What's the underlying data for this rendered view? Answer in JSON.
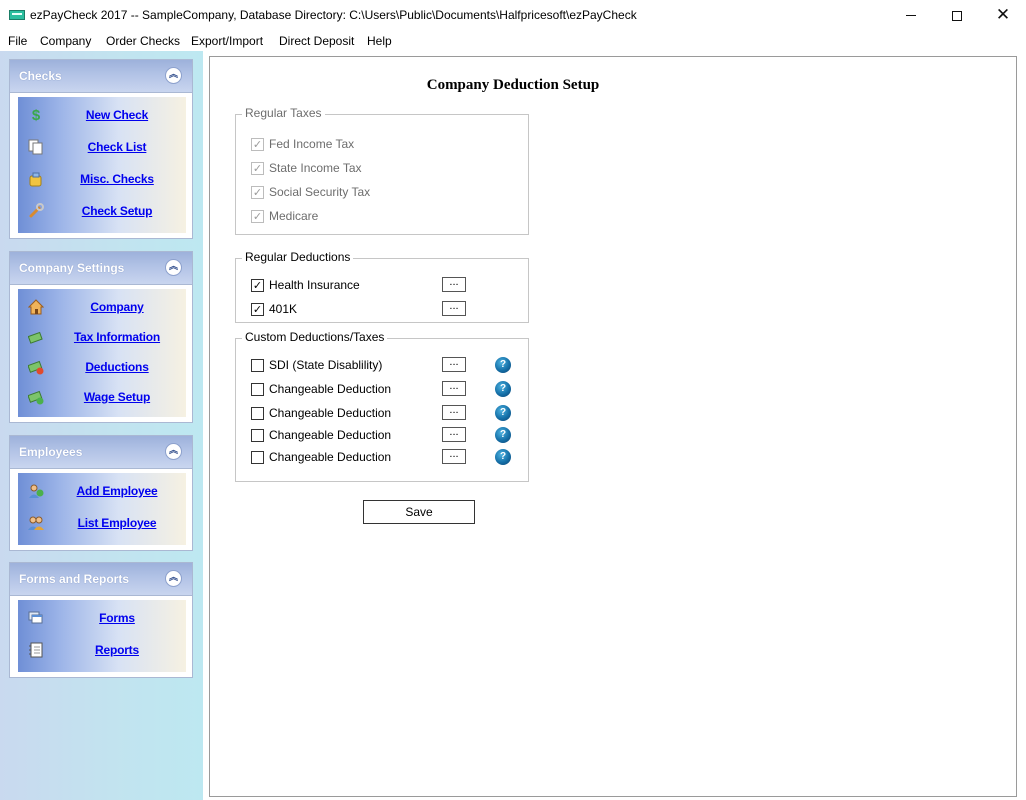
{
  "window": {
    "title": "ezPayCheck 2017 -- SampleCompany, Database Directory: C:\\Users\\Public\\Documents\\Halfpricesoft\\ezPayCheck"
  },
  "menu": [
    "File",
    "Company",
    "Order Checks",
    "Export/Import",
    "Direct Deposit",
    "Help"
  ],
  "sidebar": {
    "panels": [
      {
        "title": "Checks",
        "items": [
          {
            "label": "New Check",
            "icon": "dollar-icon"
          },
          {
            "label": "Check List",
            "icon": "documents-icon"
          },
          {
            "label": "Misc. Checks",
            "icon": "misc-check-icon"
          },
          {
            "label": "Check Setup",
            "icon": "wrench-icon"
          }
        ]
      },
      {
        "title": "Company Settings",
        "items": [
          {
            "label": "Company",
            "icon": "house-icon"
          },
          {
            "label": "Tax Information",
            "icon": "money-icon"
          },
          {
            "label": "Deductions",
            "icon": "money-minus-icon"
          },
          {
            "label": "Wage Setup",
            "icon": "money-plus-icon"
          }
        ]
      },
      {
        "title": "Employees",
        "items": [
          {
            "label": "Add Employee",
            "icon": "add-person-icon"
          },
          {
            "label": "List Employee",
            "icon": "people-icon"
          }
        ]
      },
      {
        "title": "Forms and Reports",
        "items": [
          {
            "label": "Forms",
            "icon": "forms-icon"
          },
          {
            "label": "Reports",
            "icon": "notebook-icon"
          }
        ]
      }
    ]
  },
  "main": {
    "title": "Company Deduction Setup",
    "regular_taxes": {
      "legend": "Regular Taxes",
      "items": [
        {
          "label": "Fed Income Tax",
          "checked": true
        },
        {
          "label": "State Income Tax",
          "checked": true
        },
        {
          "label": "Social Security Tax",
          "checked": true
        },
        {
          "label": "Medicare",
          "checked": true
        }
      ]
    },
    "regular_deductions": {
      "legend": "Regular Deductions",
      "items": [
        {
          "label": "Health Insurance",
          "checked": true,
          "button": "..."
        },
        {
          "label": "401K",
          "checked": true,
          "button": "..."
        }
      ]
    },
    "custom_deductions": {
      "legend": "Custom Deductions/Taxes",
      "items": [
        {
          "label": "SDI (State Disablility)",
          "checked": false,
          "button": "...",
          "help": "?"
        },
        {
          "label": "Changeable Deduction",
          "checked": false,
          "button": "...",
          "help": "?"
        },
        {
          "label": "Changeable Deduction",
          "checked": false,
          "button": "...",
          "help": "?"
        },
        {
          "label": "Changeable Deduction",
          "checked": false,
          "button": "...",
          "help": "?"
        },
        {
          "label": "Changeable Deduction",
          "checked": false,
          "button": "...",
          "help": "?"
        }
      ]
    },
    "save_label": "Save"
  },
  "colors": {
    "link": "#0000ee",
    "panel_header": "#9db1db",
    "sidebar_background": "#c2e3ef",
    "help_icon": "#1570a8"
  }
}
